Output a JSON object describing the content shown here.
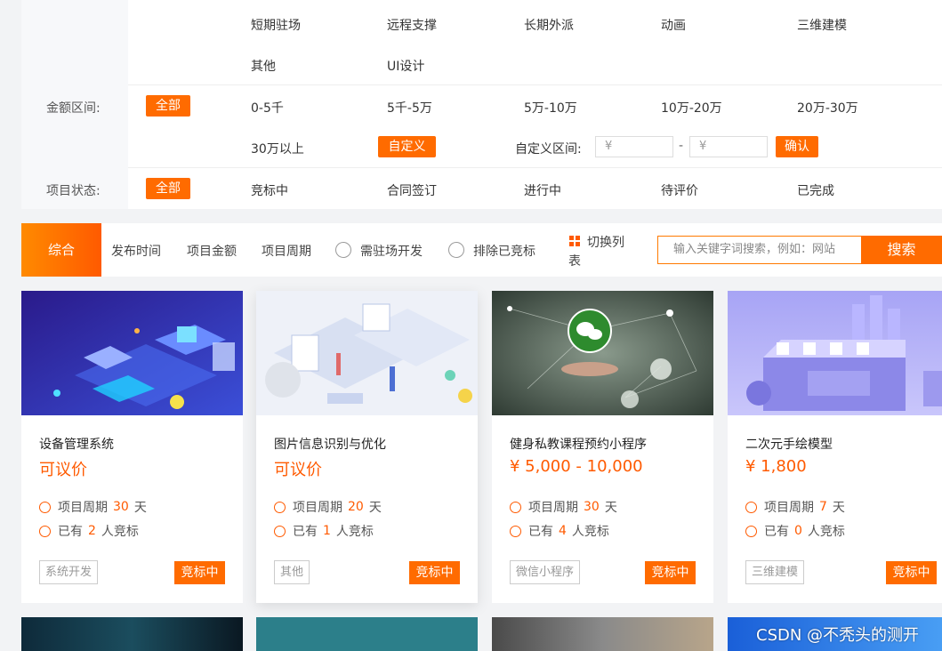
{
  "filters": {
    "type_row1": [
      "短期驻场",
      "远程支撑",
      "长期外派",
      "动画",
      "三维建模"
    ],
    "type_row2": [
      "其他",
      "UI设计"
    ],
    "amount_label": "金额区间:",
    "all_label": "全部",
    "amount_row1": [
      "0-5千",
      "5千-5万",
      "5万-10万",
      "10万-20万",
      "20万-30万"
    ],
    "amount_over": "30万以上",
    "custom_btn": "自定义",
    "custom_range_label": "自定义区间:",
    "min_placeholder": "¥",
    "range_dash": "-",
    "max_placeholder": "¥",
    "confirm_btn": "确认",
    "status_label": "项目状态:",
    "status_options": [
      "竞标中",
      "合同签订",
      "进行中",
      "待评价",
      "已完成"
    ]
  },
  "toolbar": {
    "active_tab": "综合",
    "sort_items": [
      "发布时间",
      "项目金额",
      "项目周期"
    ],
    "radio1": "需驻场开发",
    "radio2": "排除已竞标",
    "switch_line1": "切换列",
    "switch_line2": "表",
    "search_placeholder": "输入关键字词搜索，例如：网站",
    "search_btn": "搜索"
  },
  "cards": [
    {
      "title": "设备管理系统",
      "price": "可议价",
      "period_label": "项目周期",
      "period_value": "30",
      "period_unit": "天",
      "bid_prefix": "已有",
      "bid_count": "2",
      "bid_suffix": "人竞标",
      "category": "系统开发",
      "status": "竞标中"
    },
    {
      "title": "图片信息识别与优化",
      "price": "可议价",
      "period_label": "项目周期",
      "period_value": "20",
      "period_unit": "天",
      "bid_prefix": "已有",
      "bid_count": "1",
      "bid_suffix": "人竞标",
      "category": "其他",
      "status": "竞标中"
    },
    {
      "title": "健身私教课程预约小程序",
      "price": "¥ 5,000 - 10,000",
      "period_label": "项目周期",
      "period_value": "30",
      "period_unit": "天",
      "bid_prefix": "已有",
      "bid_count": "4",
      "bid_suffix": "人竞标",
      "category": "微信小程序",
      "status": "竞标中"
    },
    {
      "title": "二次元手绘模型",
      "price": "¥ 1,800",
      "period_label": "项目周期",
      "period_value": "7",
      "period_unit": "天",
      "bid_prefix": "已有",
      "bid_count": "0",
      "bid_suffix": "人竞标",
      "category": "三维建模",
      "status": "竞标中"
    }
  ],
  "watermark": "CSDN @不秃头的测开",
  "colors": {
    "accent": "#ff6b00",
    "price": "#ff5a00"
  }
}
